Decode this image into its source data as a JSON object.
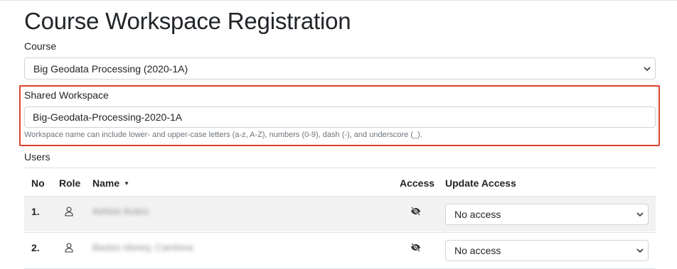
{
  "page": {
    "title": "Course Workspace Registration"
  },
  "course": {
    "label": "Course",
    "selected": "Big Geodata Processing (2020-1A)"
  },
  "workspace": {
    "label": "Shared Workspace",
    "value": "Big-Geodata-Processing-2020-1A",
    "help": "Workspace name can include lower- and upper-case letters (a-z, A-Z), numbers (0-9), dash (-), and underscore (_).",
    "highlight_color": "#d9432c"
  },
  "users": {
    "label": "Users",
    "columns": {
      "no": "No",
      "role": "Role",
      "name": "Name",
      "sort_indicator": "▼",
      "access": "Access",
      "update": "Update Access"
    },
    "rows": [
      {
        "no": "1.",
        "role_icon": "user-icon",
        "name": "Ashton Avans",
        "access_icon": "eye-slash-icon",
        "update_value": "No access"
      },
      {
        "no": "2.",
        "role_icon": "user-icon",
        "name": "Bastos Idoney, Carolona",
        "access_icon": "eye-slash-icon",
        "update_value": "No access"
      }
    ]
  }
}
